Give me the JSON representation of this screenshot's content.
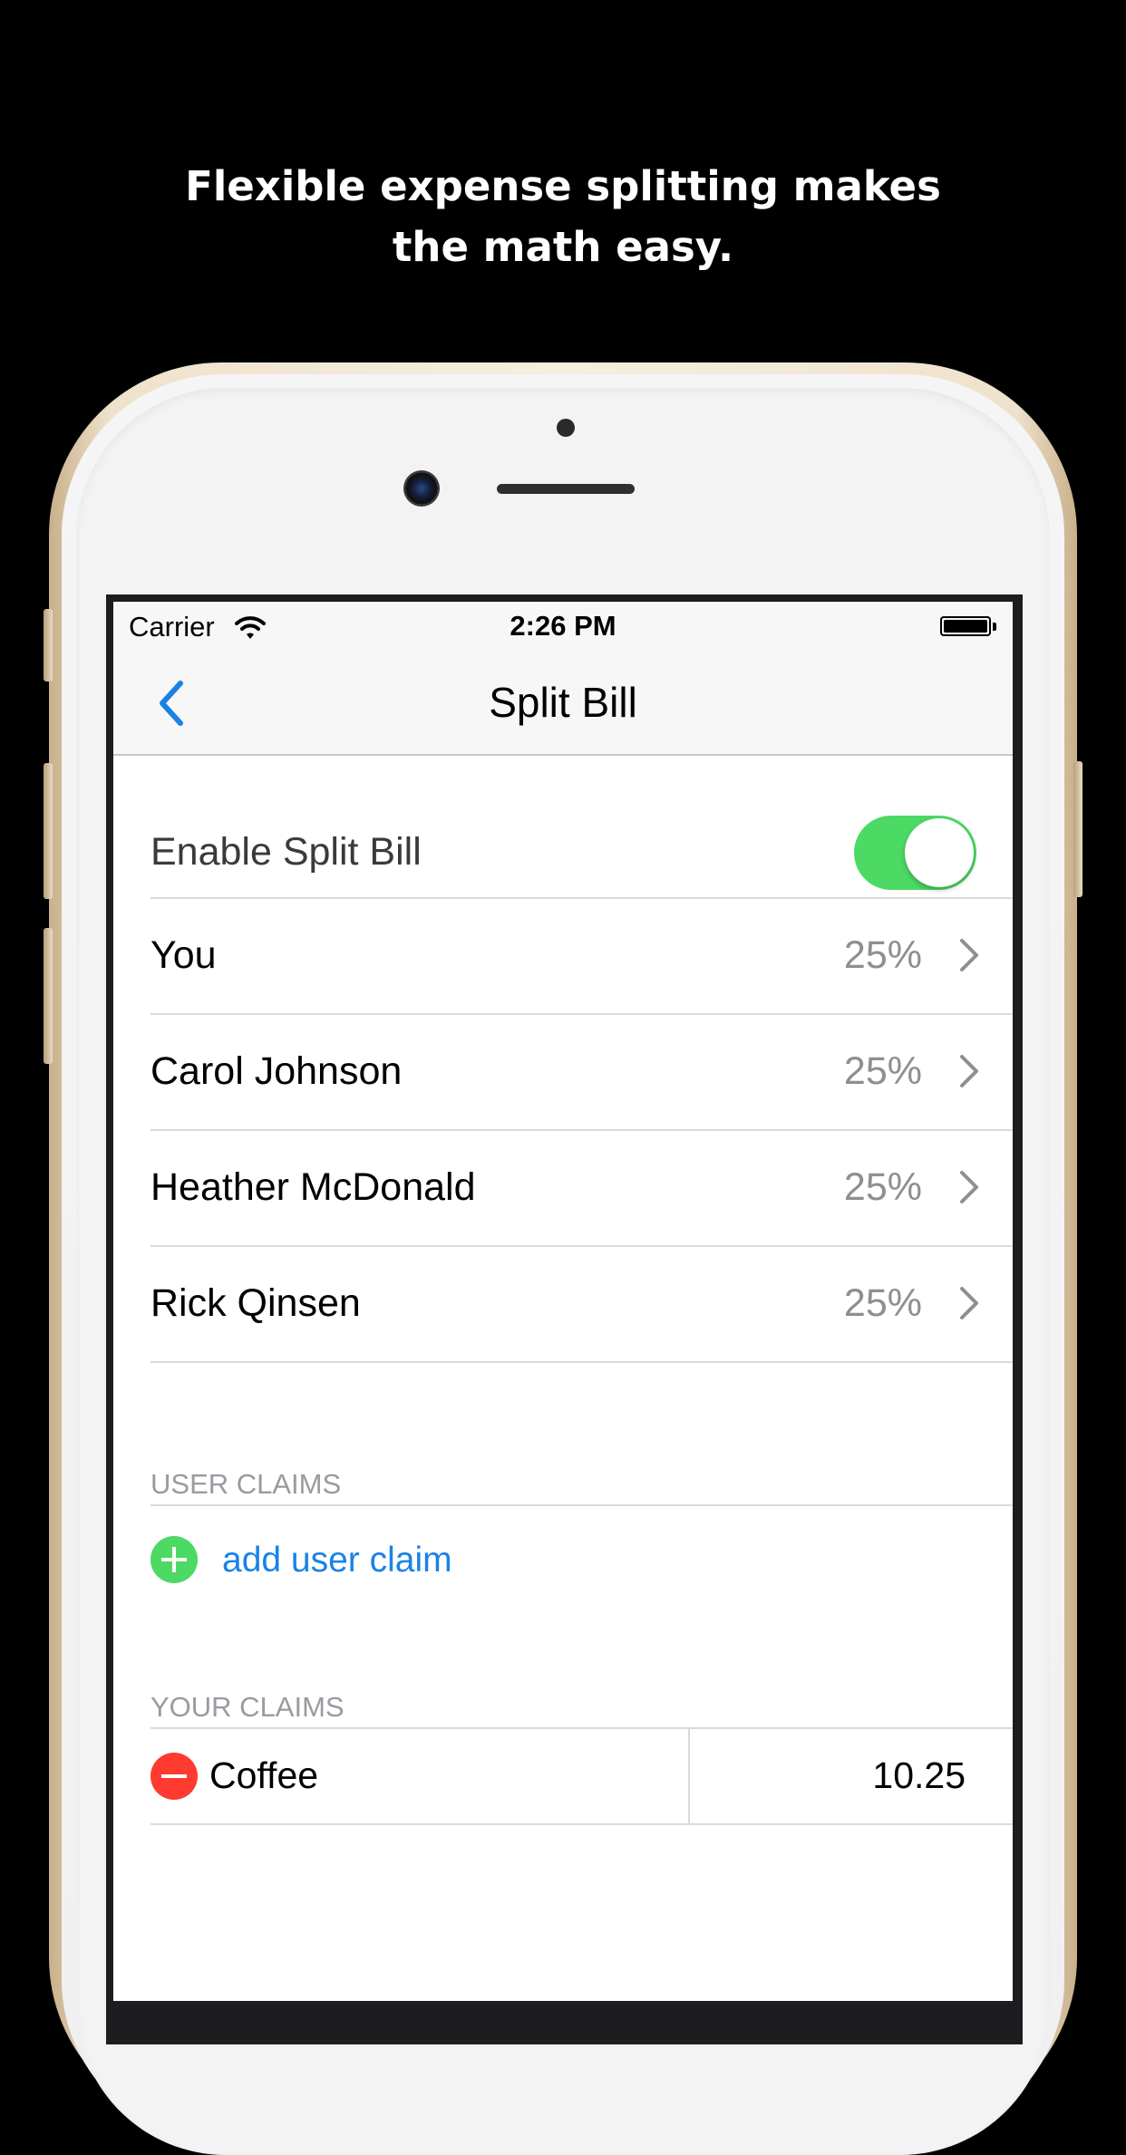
{
  "headline": {
    "line1": "Flexible expense splitting makes",
    "line2": "the math easy."
  },
  "status_bar": {
    "carrier": "Carrier",
    "time": "2:26 PM"
  },
  "nav": {
    "title": "Split Bill",
    "back_icon": "chevron-left-icon"
  },
  "enable_row": {
    "label": "Enable Split Bill",
    "toggle_on": true,
    "toggle_color": "#4cd964"
  },
  "participants": [
    {
      "name": "You",
      "share": "25%"
    },
    {
      "name": "Carol Johnson",
      "share": "25%"
    },
    {
      "name": "Heather McDonald",
      "share": "25%"
    },
    {
      "name": "Rick Qinsen",
      "share": "25%"
    }
  ],
  "user_claims": {
    "header": "USER CLAIMS",
    "add_label": "add user claim",
    "add_color": "#4cd964"
  },
  "your_claims": {
    "header": "YOUR CLAIMS",
    "items": [
      {
        "name": "Coffee",
        "amount": "10.25"
      }
    ],
    "remove_color": "#ff3b30"
  },
  "colors": {
    "accent": "#1a82e6",
    "secondary_text": "#8e8e93"
  }
}
